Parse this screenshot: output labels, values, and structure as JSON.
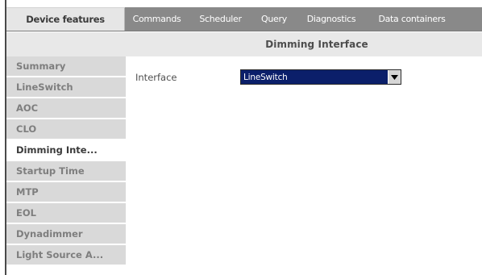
{
  "colors": {
    "tab_bar_bg": "#898989",
    "active_tab_bg": "#e6e6e6",
    "header_bg": "#e8e8e8",
    "sidebar_item_bg": "#d9d9d9",
    "sidebar_active_bg": "#ffffff",
    "select_bg": "#0b1f6a"
  },
  "tabs": [
    {
      "label": "Device features",
      "active": true
    },
    {
      "label": "Commands",
      "active": false
    },
    {
      "label": "Scheduler",
      "active": false
    },
    {
      "label": "Query",
      "active": false
    },
    {
      "label": "Diagnostics",
      "active": false
    },
    {
      "label": "Data containers",
      "active": false
    }
  ],
  "content": {
    "title": "Dimming Interface"
  },
  "sidebar": {
    "items": [
      {
        "label": "Summary",
        "active": false
      },
      {
        "label": "LineSwitch",
        "active": false
      },
      {
        "label": "AOC",
        "active": false
      },
      {
        "label": "CLO",
        "active": false
      },
      {
        "label": "Dimming Inte...",
        "active": true
      },
      {
        "label": "Startup Time",
        "active": false
      },
      {
        "label": "MTP",
        "active": false
      },
      {
        "label": "EOL",
        "active": false
      },
      {
        "label": "Dynadimmer",
        "active": false
      },
      {
        "label": "Light Source A...",
        "active": false
      }
    ]
  },
  "form": {
    "interface_label": "Interface",
    "interface_select": {
      "value": "LineSwitch",
      "icon": "chevron-down-icon"
    }
  }
}
